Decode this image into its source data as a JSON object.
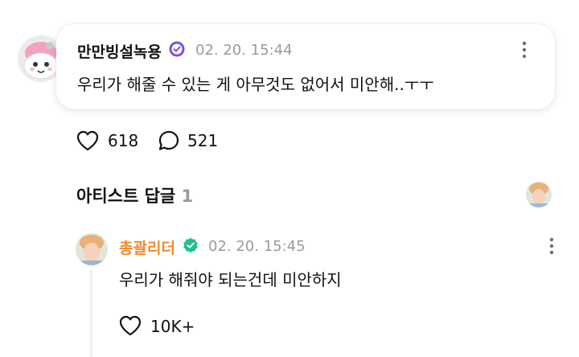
{
  "fan_comment": {
    "author": "만만빙설녹용",
    "timestamp": "02. 20. 15:44",
    "text": "우리가 해줄 수 있는 게 아무것도 없어서 미안해..ㅜㅜ",
    "badge_icon": "verified-fan-icon",
    "more_icon": "more-vertical-icon"
  },
  "reactions": {
    "likes": "618",
    "comments": "521",
    "like_icon": "heart-icon",
    "comment_icon": "comment-bubble-icon"
  },
  "artist_section": {
    "title": "아티스트 답글",
    "count": "1"
  },
  "artist_reply": {
    "author": "총괄리더",
    "timestamp": "02. 20. 15:45",
    "text": "우리가 해줘야 되는건데 미안하지",
    "likes": "10K+",
    "badge_icon": "verified-artist-icon",
    "more_icon": "more-vertical-icon"
  },
  "colors": {
    "artist_name": "#f08a2c",
    "fan_badge": "#7a4fe0",
    "artist_badge": "#1fbf8f",
    "muted": "#9a9a9e"
  }
}
